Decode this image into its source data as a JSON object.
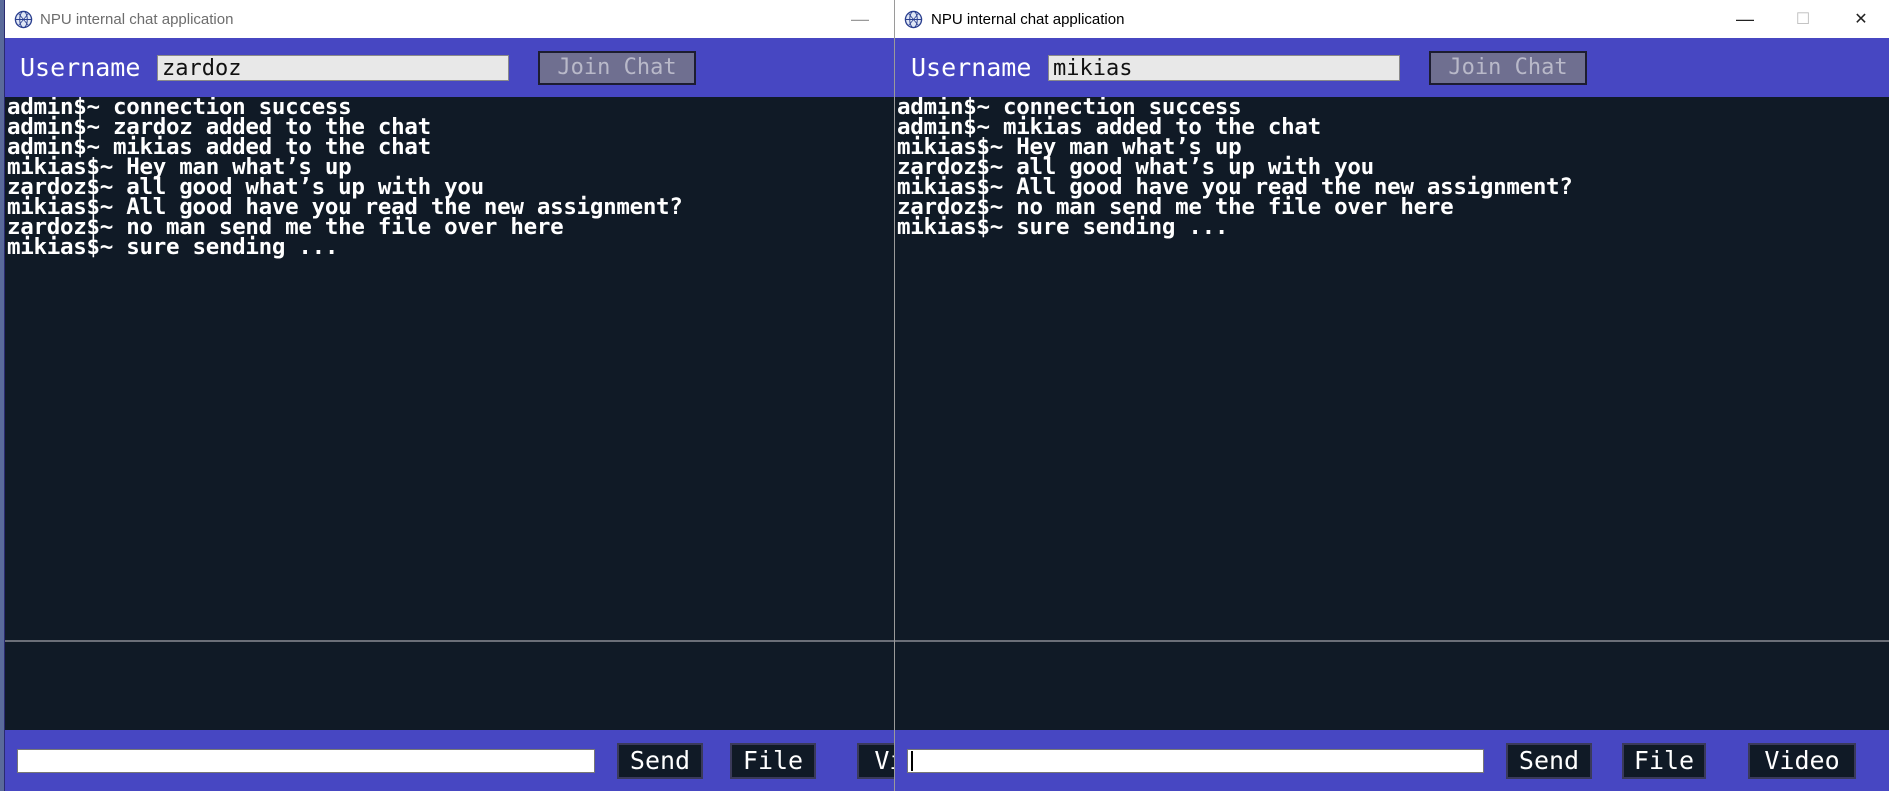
{
  "left_window": {
    "title": "NPU internal chat application",
    "controls": {
      "minimize": "—"
    },
    "username_label": "Username",
    "username_value": "zardoz",
    "join_label": "Join Chat",
    "messages": [
      "admin$~ connection success",
      "admin$~ zardoz added to the chat",
      "admin$~ mikias added to the chat",
      "mikias$~ Hey man what’s up",
      "zardoz$~ all good what’s up with you",
      "mikias$~ All good have you read the new assignment?",
      "zardoz$~ no man send me the file over here",
      "mikias$~ sure sending ..."
    ],
    "message_input_value": "",
    "send_label": "Send",
    "file_label": "File",
    "video_label": "Video"
  },
  "right_window": {
    "title": "NPU internal chat application",
    "controls": {
      "minimize": "—",
      "maximize": "☐",
      "close": "✕"
    },
    "username_label": "Username",
    "username_value": "mikias",
    "join_label": "Join Chat",
    "messages": [
      "admin$~ connection success",
      "admin$~ mikias added to the chat",
      "mikias$~ Hey man what’s up",
      "zardoz$~ all good what’s up with you",
      "mikias$~ All good have you read the new assignment?",
      "zardoz$~ no man send me the file over here",
      "mikias$~ sure sending ..."
    ],
    "message_input_value": "",
    "send_label": "Send",
    "file_label": "File",
    "video_label": "Video"
  },
  "colors": {
    "panel_blue": "#4747c2",
    "chat_background": "#101a26",
    "chat_text": "#ffffff"
  },
  "icons": {
    "app_icon": "npu-globe-icon"
  }
}
